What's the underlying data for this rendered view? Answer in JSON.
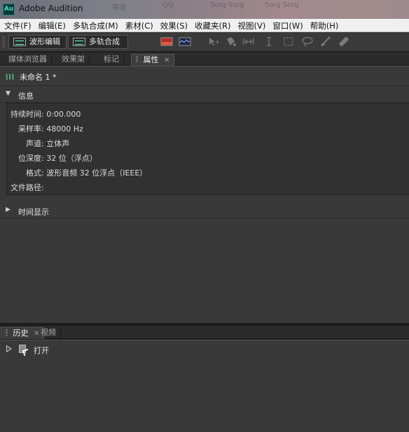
{
  "window": {
    "title": "Adobe Audition",
    "icon_text": "Au",
    "background_tabs": [
      "等待",
      "QQ",
      "Sorg Sorg",
      "Sorg Sorg"
    ]
  },
  "menu": [
    "文件(F)",
    "编辑(E)",
    "多轨合成(M)",
    "素材(C)",
    "效果(S)",
    "收藏夹(R)",
    "视图(V)",
    "窗口(W)",
    "帮助(H)"
  ],
  "toolbar": {
    "waveform_label": "波形编辑",
    "multitrack_label": "多轨合成",
    "icons": [
      "spectral-frequency-icon",
      "spectral-pitch-icon",
      "move-tool-icon",
      "razor-tool-icon",
      "slip-tool-icon",
      "time-selection-icon",
      "marquee-icon",
      "lasso-icon",
      "brush-icon",
      "spot-healing-icon"
    ]
  },
  "top_tabs": [
    {
      "label": "媒体浏览器",
      "active": false
    },
    {
      "label": "效果架",
      "active": false
    },
    {
      "label": "标记",
      "active": false
    },
    {
      "label": "属性",
      "active": true
    }
  ],
  "properties": {
    "file_name": "未命名 1 *",
    "info_section": "信息",
    "info": [
      {
        "key": "持续时间:",
        "value": "0:00.000"
      },
      {
        "key": "采样率:",
        "value": "48000 Hz"
      },
      {
        "key": "声道:",
        "value": "立体声"
      },
      {
        "key": "位深度:",
        "value": "32 位（浮点）"
      },
      {
        "key": "格式:",
        "value": "波形音频 32 位浮点（IEEE）"
      },
      {
        "key": "文件路径:",
        "value": ""
      }
    ],
    "time_section": "时间显示"
  },
  "bottom_tabs": [
    {
      "label": "历史",
      "active": true
    },
    {
      "label": "视频",
      "active": false
    }
  ],
  "history": [
    {
      "label": "打开"
    }
  ],
  "colors": {
    "panel_bg": "#393939",
    "accent_wave": "#5fd4a6"
  }
}
